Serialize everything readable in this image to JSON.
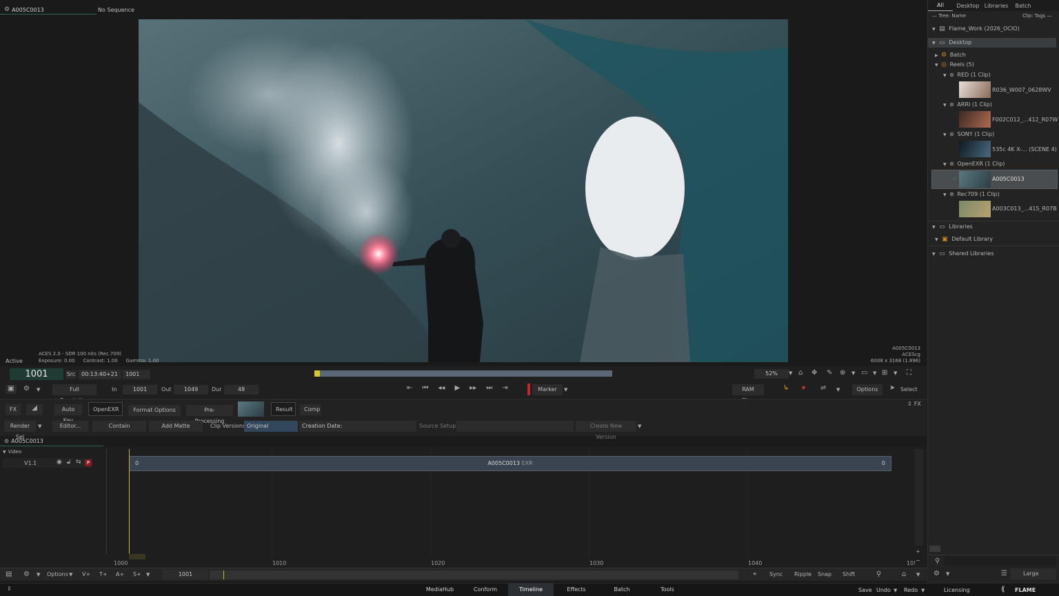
{
  "viewer": {
    "clip_name": "A005C0013",
    "sequence": "No Sequence",
    "status": "Active",
    "color_line1": "ACES 2.0 - SDR 100 nits (Rec.709)",
    "exposure": "Exposure: 0.00",
    "contrast": "Contrast: 1.00",
    "gamma": "Gamma: 1.00",
    "meta_name": "A005C0013",
    "meta_space": "ACEScg",
    "meta_res": "6008 x 3168 (1.896)"
  },
  "transport": {
    "frame": "1001",
    "src_label": "Src",
    "timecode": "00:13:40+21",
    "src_frame": "1001",
    "in_label": "In",
    "in_val": "1001",
    "out_label": "Out",
    "out_val": "1049",
    "dur_label": "Dur",
    "dur_val": "48",
    "resolution": "Full Resolution",
    "marker": "Marker",
    "zoom": "52%",
    "ram_play": "RAM Play",
    "options": "Options",
    "select": "Select",
    "scrub_progress": 0.01
  },
  "clip_bar": {
    "fx": "FX",
    "auto_key": "Auto Key",
    "openexr": "OpenEXR",
    "format_options": "Format Options",
    "pre_processing": "Pre-Processing",
    "result": "Result",
    "comp": "Comp",
    "fx_right": "FX",
    "render_sel": "Render Sel",
    "editor": "Editor...",
    "contain": "Contain",
    "add_matte": "Add Matte",
    "clip_versions_label": "Clip Versions",
    "clip_versions_value": "Original",
    "creation_date": "Creation Date:",
    "source_setup": "Source Setup",
    "create_new_version": "Create New Version"
  },
  "timeline": {
    "header": "A005C0013",
    "video_label": "Video",
    "track": "V1.1",
    "segment_name": "A005C0013",
    "segment_type": "EXR",
    "seg_in": "0",
    "seg_out": "0",
    "ruler": [
      "1000",
      "1010",
      "1020",
      "1030",
      "1040",
      "10!"
    ]
  },
  "bottombar": {
    "options": "Options",
    "v_plus": "V+",
    "t_plus": "T+",
    "a_plus": "A+",
    "s_plus": "S+",
    "frame": "1001",
    "sync": "Sync",
    "ripple": "Ripple",
    "snap": "Snap",
    "shift": "Shift",
    "large": "Large"
  },
  "appbar": {
    "tabs": [
      "MediaHub",
      "Conform",
      "Timeline",
      "Effects",
      "Batch",
      "Tools"
    ],
    "active_tab": "Timeline",
    "save": "Save",
    "undo": "Undo",
    "redo": "Redo",
    "licensing": "Licensing",
    "brand": "FLAME"
  },
  "media_panel": {
    "tabs": [
      "All",
      "Desktop",
      "Libraries",
      "Batch"
    ],
    "tree_name": "— Tree: Name",
    "clip_tags": "Clip: Tags —",
    "project": "Flame_Work (2026_OCIO)",
    "desktop": "Desktop",
    "batch": "Batch",
    "reels": "Reels (5)",
    "groups": [
      {
        "label": "RED (1 Clip)",
        "clip": "R036_W007_0628WV"
      },
      {
        "label": "ARRI (1 Clip)",
        "clip": "F002C012_...412_R07W"
      },
      {
        "label": "SONY (1 Clip)",
        "clip": "535c 4K X-... (SCENE 4)"
      },
      {
        "label": "OpenEXR (1 Clip)",
        "clip": "A005C0013"
      },
      {
        "label": "Rec709 (1 Clip)",
        "clip": "A003C013_...415_R07B"
      }
    ],
    "libraries": "Libraries",
    "default_library": "Default Library",
    "shared_libraries": "Shared Libraries"
  },
  "colors": {
    "accent_blue": "#3f5f7f",
    "frame_green": "#1f3b33",
    "playhead_yellow": "#c9b52a",
    "record_red": "#c8232c"
  }
}
